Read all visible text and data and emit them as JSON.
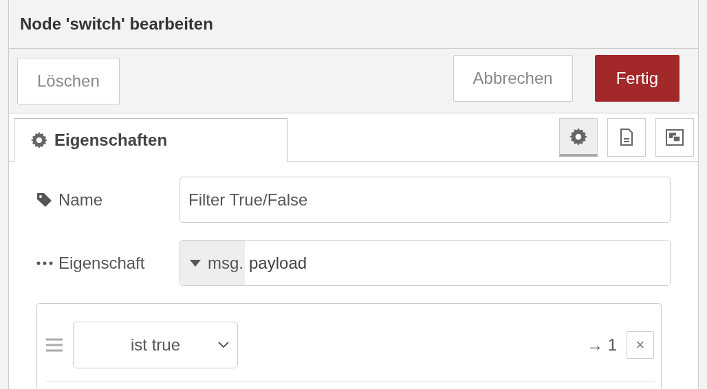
{
  "window": {
    "title": "Node 'switch' bearbeiten"
  },
  "buttons": [
    {
      "label": "Löschen",
      "kind": "plain"
    },
    {
      "label": "Abbrechen",
      "kind": "plain"
    },
    {
      "label": "Fertig",
      "kind": "primary"
    }
  ],
  "tabs": [
    {
      "label": "Eigenschaften",
      "selected": true
    }
  ],
  "icon_tabs": [
    {
      "kind": "gear",
      "selected": true
    },
    {
      "kind": "document",
      "selected": false
    },
    {
      "kind": "frame",
      "selected": false
    }
  ],
  "fields": [
    {
      "label": "Name",
      "kind": "tag",
      "value": "Filter True/False"
    },
    {
      "label": "Eigenschaft",
      "kind": "dots",
      "prefix": "msg.",
      "value": "payload"
    }
  ],
  "rules": [
    {
      "operator": "ist true",
      "output": "→ 1",
      "remove": "×"
    }
  ]
}
